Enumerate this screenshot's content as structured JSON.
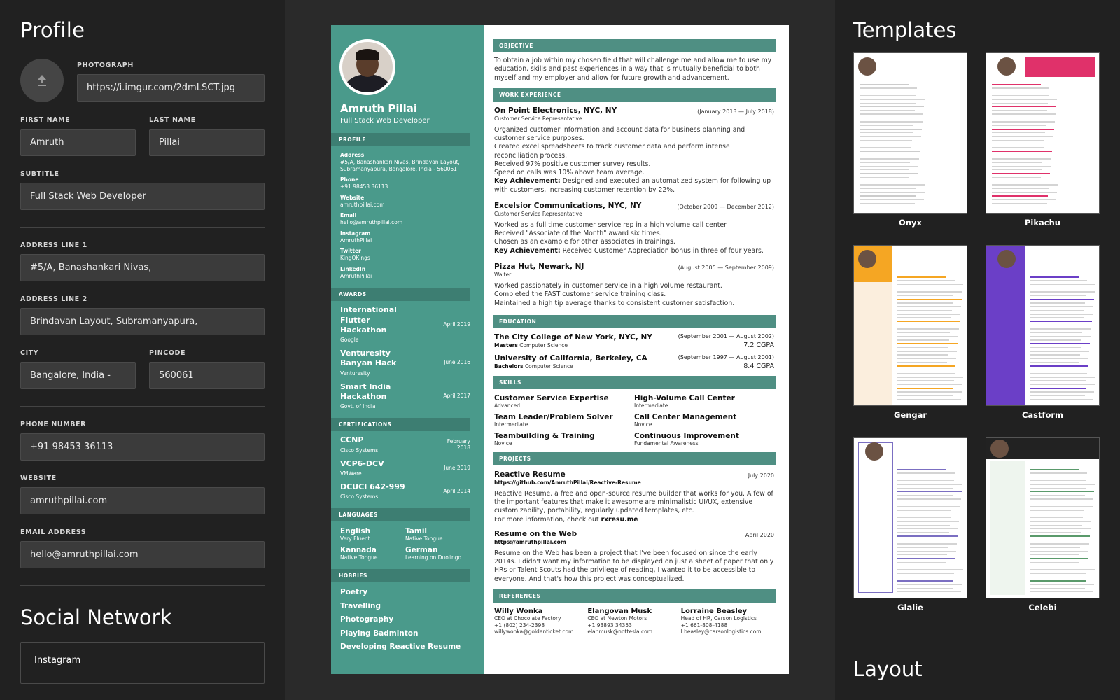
{
  "profile": {
    "title": "Profile",
    "photo_label": "PHOTOGRAPH",
    "photo_value": "https://i.imgur.com/2dmLSCT.jpg",
    "first_name_label": "FIRST NAME",
    "first_name_value": "Amruth",
    "last_name_label": "LAST NAME",
    "last_name_value": "Pillai",
    "subtitle_label": "SUBTITLE",
    "subtitle_value": "Full Stack Web Developer",
    "address1_label": "ADDRESS LINE 1",
    "address1_value": "#5/A, Banashankari Nivas,",
    "address2_label": "ADDRESS LINE 2",
    "address2_value": "Brindavan Layout, Subramanyapura,",
    "city_label": "CITY",
    "city_value": "Bangalore, India -",
    "pincode_label": "PINCODE",
    "pincode_value": "560061",
    "phone_label": "PHONE NUMBER",
    "phone_value": "+91 98453 36113",
    "website_label": "WEBSITE",
    "website_value": "amruthpillai.com",
    "email_label": "EMAIL ADDRESS",
    "email_value": "hello@amruthpillai.com"
  },
  "social": {
    "title": "Social Network",
    "first_item": "Instagram"
  },
  "resume": {
    "name": "Amruth Pillai",
    "subtitle": "Full Stack Web Developer",
    "profile_head": "PROFILE",
    "contacts": [
      {
        "label": "Address",
        "value": "#5/A, Banashankari Nivas, Brindavan Layout, Subramanyapura, Bangalore, India - 560061"
      },
      {
        "label": "Phone",
        "value": "+91 98453 36113"
      },
      {
        "label": "Website",
        "value": "amruthpillai.com"
      },
      {
        "label": "Email",
        "value": "hello@amruthpillai.com"
      },
      {
        "label": "Instagram",
        "value": "AmruthPillai"
      },
      {
        "label": "Twitter",
        "value": "KingOKings"
      },
      {
        "label": "LinkedIn",
        "value": "AmruthPillai"
      }
    ],
    "awards_head": "AWARDS",
    "awards": [
      {
        "title": "International Flutter Hackathon",
        "sub": "Google",
        "date": "April 2019"
      },
      {
        "title": "Venturesity Banyan Hack",
        "sub": "Venturesity",
        "date": "June 2016"
      },
      {
        "title": "Smart India Hackathon",
        "sub": "Govt. of India",
        "date": "April 2017"
      }
    ],
    "certs_head": "CERTIFICATIONS",
    "certs": [
      {
        "title": "CCNP",
        "sub": "Cisco Systems",
        "date": "February 2018"
      },
      {
        "title": "VCP6-DCV",
        "sub": "VMWare",
        "date": "June 2019"
      },
      {
        "title": "DCUCI 642-999",
        "sub": "Cisco Systems",
        "date": "April 2014"
      }
    ],
    "langs_head": "LANGUAGES",
    "langs": [
      {
        "title": "English",
        "sub": "Very Fluent"
      },
      {
        "title": "Tamil",
        "sub": "Native Tongue"
      },
      {
        "title": "Kannada",
        "sub": "Native Tongue"
      },
      {
        "title": "German",
        "sub": "Learning on Duolingo"
      }
    ],
    "hobbies_head": "HOBBIES",
    "hobbies": [
      "Poetry",
      "Travelling",
      "Photography",
      "Playing Badminton",
      "Developing Reactive Resume"
    ],
    "objective_head": "OBJECTIVE",
    "objective": "To obtain a job within my chosen field that will challenge me and allow me to use my education, skills and past experiences in a way that is mutually beneficial to both myself and my employer and allow for future growth and advancement.",
    "work_head": "WORK EXPERIENCE",
    "work": [
      {
        "title": "On Point Electronics, NYC, NY",
        "date": "(January 2013 — July 2018)",
        "role": "Customer Service Representative",
        "lines": [
          "Organized customer information and account data for business planning and customer service purposes.",
          "Created excel spreadsheets to track customer data and perform intense reconciliation process.",
          "Received 97% positive customer survey results.",
          "Speed on calls was 10% above team average."
        ],
        "key_label": "Key Achievement:",
        "key": "Designed and executed an automatized system for following up with customers, increasing customer retention by 22%."
      },
      {
        "title": "Excelsior Communications, NYC, NY",
        "date": "(October 2009 — December 2012)",
        "role": "Customer Service Representative",
        "lines": [
          "Worked as a full time customer service rep in a high volume call center.",
          "Received \"Associate of the Month\" award six times.",
          "Chosen as an example for other associates in trainings."
        ],
        "key_label": "Key Achievement:",
        "key": "Received Customer Appreciation bonus in three of four years."
      },
      {
        "title": "Pizza Hut, Newark, NJ",
        "date": "(August 2005 — September 2009)",
        "role": "Waiter",
        "lines": [
          "Worked passionately in customer service in a high volume restaurant.",
          "Completed the FAST customer service training class.",
          "Maintained a high tip average thanks to consistent customer satisfaction."
        ],
        "key_label": "",
        "key": ""
      }
    ],
    "edu_head": "EDUCATION",
    "edu": [
      {
        "title": "The City College of New York, NYC, NY",
        "degree": "Masters",
        "field": "Computer Science",
        "date": "(September 2001 — August 2002)",
        "grade": "7.2 CGPA"
      },
      {
        "title": "University of California, Berkeley, CA",
        "degree": "Bachelors",
        "field": "Computer Science",
        "date": "(September 1997 — August 2001)",
        "grade": "8.4 CGPA"
      }
    ],
    "skills_head": "SKILLS",
    "skills": [
      {
        "title": "Customer Service Expertise",
        "level": "Advanced"
      },
      {
        "title": "High-Volume Call Center",
        "level": "Intermediate"
      },
      {
        "title": "Team Leader/Problem Solver",
        "level": "Intermediate"
      },
      {
        "title": "Call Center Management",
        "level": "Novice"
      },
      {
        "title": "Teambuilding & Training",
        "level": "Novice"
      },
      {
        "title": "Continuous Improvement",
        "level": "Fundamental Awareness"
      }
    ],
    "projects_head": "PROJECTS",
    "projects": [
      {
        "title": "Reactive Resume",
        "url": "https://github.com/AmruthPillai/Reactive-Resume",
        "date": "July 2020",
        "desc": "Reactive Resume, a free and open-source resume builder that works for you. A few of the important features that make it awesome are minimalistic UI/UX, extensive customizability, portability, regularly updated templates, etc.",
        "more_text": "For more information, check out ",
        "more_link": "rxresu.me"
      },
      {
        "title": "Resume on the Web",
        "url": "https://amruthpillai.com",
        "date": "April 2020",
        "desc": "Resume on the Web has been a project that I've been focused on since the early 2014s. I didn't want my information to be displayed on just a sheet of paper that only HRs or Talent Scouts had the privilege of reading, I wanted it to be accessible to everyone. And that's how this project was conceptualized.",
        "more_text": "",
        "more_link": ""
      }
    ],
    "refs_head": "REFERENCES",
    "refs": [
      {
        "name": "Willy Wonka",
        "pos": "CEO at Chocolate Factory",
        "phone": "+1 (802) 234-2398",
        "email": "willywonka@goldenticket.com"
      },
      {
        "name": "Elangovan Musk",
        "pos": "CEO at Newton Motors",
        "phone": "+1 93893 34353",
        "email": "elanmusk@nottesla.com"
      },
      {
        "name": "Lorraine Beasley",
        "pos": "Head of HR, Carson Logistics",
        "phone": "+1 661-808-4188",
        "email": "l.beasley@carsonlogistics.com"
      }
    ]
  },
  "templates": {
    "title": "Templates",
    "items": [
      {
        "name": "Onyx",
        "accent": "#cccccc"
      },
      {
        "name": "Pikachu",
        "accent": "#e0316a"
      },
      {
        "name": "Gengar",
        "accent": "#f5a623"
      },
      {
        "name": "Castform",
        "accent": "#6b3fc7"
      },
      {
        "name": "Glalie",
        "accent": "#7b6fc2"
      },
      {
        "name": "Celebi",
        "accent": "#5a9a6b"
      }
    ]
  },
  "layout": {
    "title": "Layout"
  },
  "colors": {
    "teal": "#4a9a8b",
    "teal_dark": "#3d7e72",
    "panel": "#212121",
    "bg": "#2a2a2a"
  }
}
